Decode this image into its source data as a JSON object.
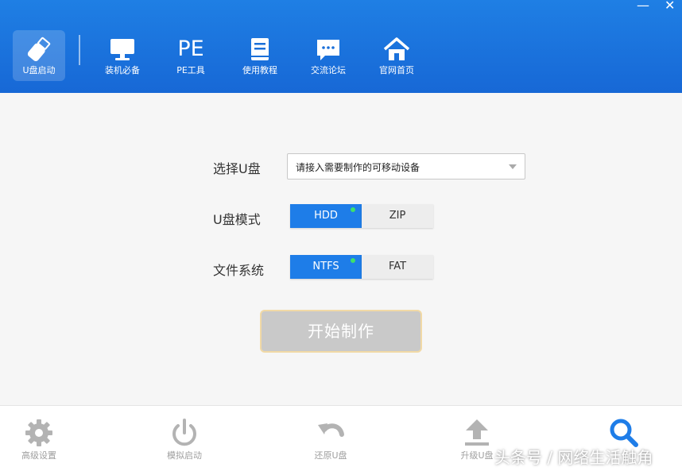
{
  "window": {
    "minimize_glyph": "—",
    "close_glyph": "✕"
  },
  "nav": {
    "items": [
      {
        "label": "U盘启动",
        "icon": "usb-drive-icon"
      },
      {
        "label": "装机必备",
        "icon": "monitor-icon"
      },
      {
        "label": "PE工具",
        "icon": "pe-icon",
        "icon_text": "PE"
      },
      {
        "label": "使用教程",
        "icon": "book-icon"
      },
      {
        "label": "交流论坛",
        "icon": "chat-bubble-icon"
      },
      {
        "label": "官网首页",
        "icon": "home-icon"
      }
    ]
  },
  "form": {
    "select_label": "选择U盘",
    "select_value": "请接入需要制作的可移动设备",
    "mode_label": "U盘模式",
    "mode_options": [
      "HDD",
      "ZIP"
    ],
    "mode_selected": "HDD",
    "fs_label": "文件系统",
    "fs_options": [
      "NTFS",
      "FAT"
    ],
    "fs_selected": "NTFS",
    "start_label": "开始制作"
  },
  "bottom": {
    "items": [
      {
        "label": "高级设置",
        "icon": "gear-icon"
      },
      {
        "label": "模拟启动",
        "icon": "power-icon"
      },
      {
        "label": "还原U盘",
        "icon": "undo-icon"
      },
      {
        "label": "升级U盘",
        "icon": "upload-icon"
      },
      {
        "label": "",
        "icon": "search-icon"
      }
    ]
  },
  "watermark": "头条号 / 网络生活触角",
  "colors": {
    "accent": "#1e7de8",
    "topbar": "#1768d6",
    "indicator": "#3ee06b"
  }
}
